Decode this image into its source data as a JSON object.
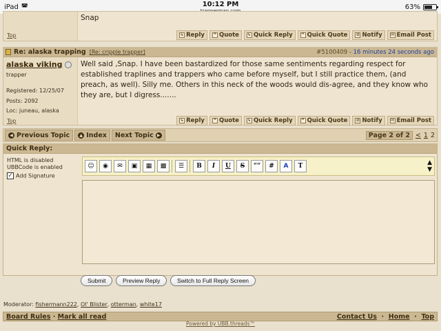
{
  "status_bar": {
    "carrier": "iPad",
    "time": "10:12 PM",
    "url": "trapperman.com",
    "battery": "63%"
  },
  "prev_post": {
    "body_tail": "Snap",
    "top_link": "Top",
    "actions": [
      "Reply",
      "Quote",
      "Quick Reply",
      "Quick Quote",
      "Notify",
      "Email Post"
    ]
  },
  "post": {
    "title": "Re: alaska trapping",
    "breadcrumb": "[Re: cripple trapper]",
    "post_number": "#5100409",
    "time_ago": "16 minutes 24 seconds ago",
    "username": "alaska viking",
    "rank": "trapper",
    "registered": "Registered: 12/25/07",
    "posts": "Posts: 2092",
    "location": "Loc: juneau, alaska",
    "body": "Well said ,Snap. I have been bastardized for those same sentiments regarding respect for established traplines and trappers who came before myself, but I still practice them, (and preach, as well). Silly me. Others in this neck of the woods would dis-agree, and they know who they are, but I digress.......",
    "top_link": "Top",
    "actions": [
      "Reply",
      "Quote",
      "Quick Reply",
      "Quick Quote",
      "Notify",
      "Email Post"
    ]
  },
  "nav": {
    "previous": "Previous Topic",
    "index": "Index",
    "next": "Next Topic",
    "page_label": "Page 2 of 2",
    "prev_symbol": "<",
    "page1": "1",
    "page2": "2"
  },
  "quick_reply": {
    "title": "Quick Reply:",
    "html_status": "HTML is disabled",
    "ubb_status": "UBBCode is enabled",
    "add_signature": "Add Signature",
    "signature_checked": true,
    "toolbar": {
      "bold": "B",
      "italic": "I",
      "underline": "U",
      "strike": "S",
      "quote": "““",
      "hash": "#",
      "color": "A",
      "font": "T"
    },
    "buttons": {
      "submit": "Submit",
      "preview": "Preview Reply",
      "full": "Switch to Full Reply Screen"
    }
  },
  "moderators": {
    "label": "Moderator:",
    "names": [
      "fishermann222",
      "Ol' Blister",
      "otterman",
      "white17"
    ]
  },
  "footer": {
    "board_rules": "Board Rules",
    "mark_all_read": "Mark all read",
    "contact_us": "Contact Us",
    "home": "Home",
    "top": "Top",
    "powered_by": "Powered by UBB.threads™"
  }
}
